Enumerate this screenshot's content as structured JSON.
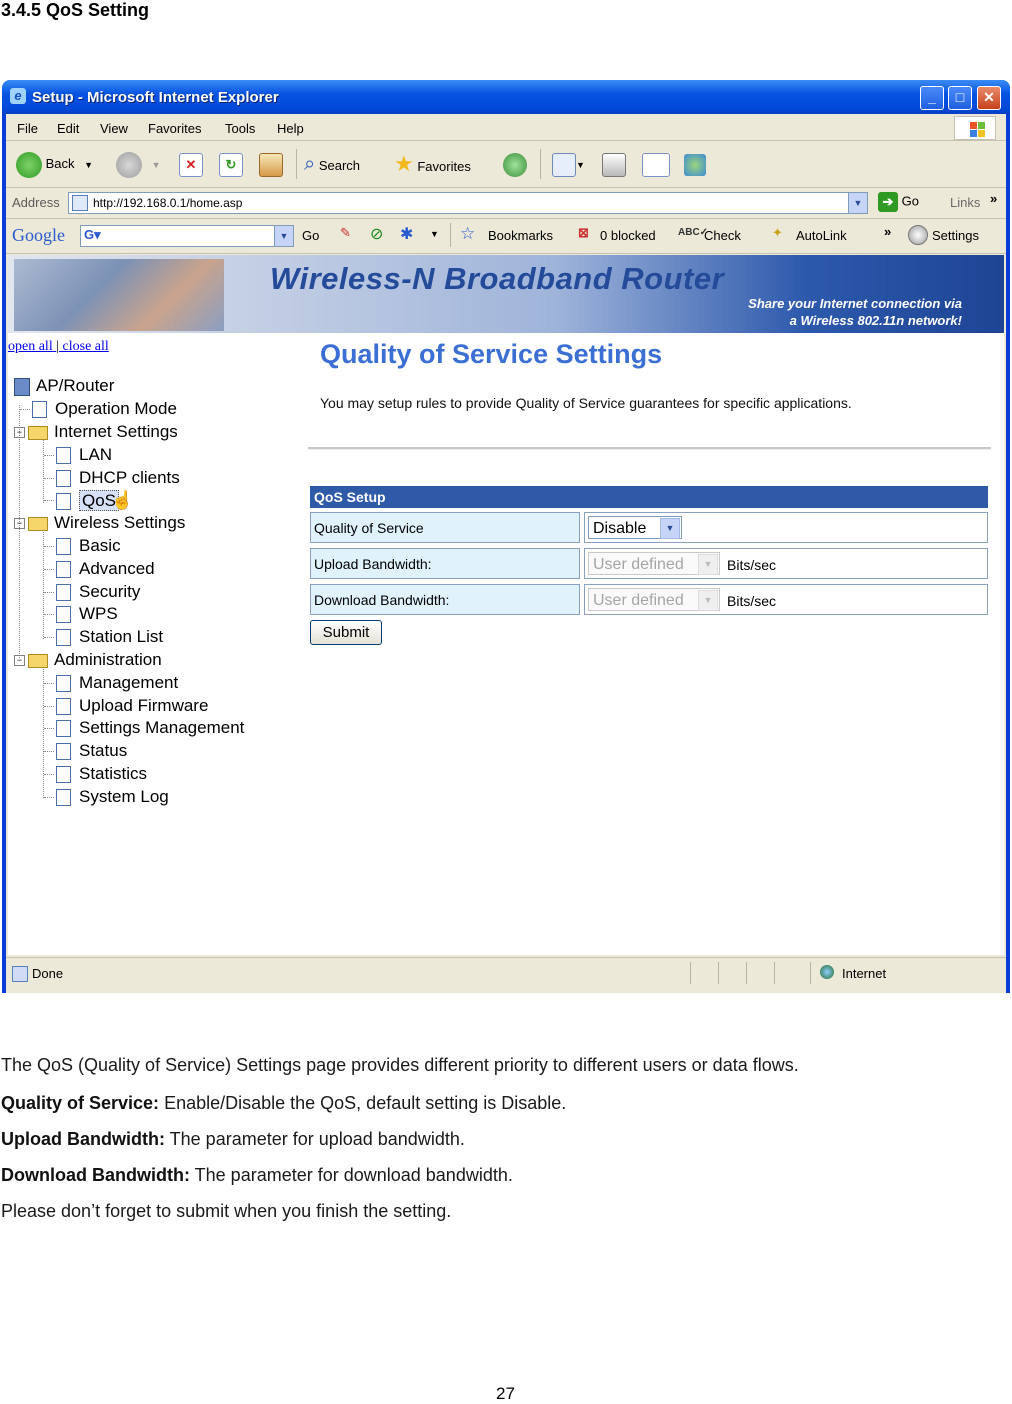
{
  "doc": {
    "heading": "3.4.5 QoS Setting",
    "intro": "The QoS (Quality of Service) Settings page provides different priority to different users or data flows.",
    "items": [
      {
        "term": "Quality of Service:",
        "desc": " Enable/Disable the QoS, default setting is Disable."
      },
      {
        "term": "Upload Bandwidth:",
        "desc": " The parameter for upload bandwidth."
      },
      {
        "term": "Download Bandwidth:",
        "desc": " The parameter for download bandwidth."
      }
    ],
    "closing": "Please don’t forget to submit when you finish the setting.",
    "page_number": "27"
  },
  "window": {
    "title": "Setup - Microsoft Internet Explorer",
    "controls": {
      "minimize": "_",
      "maximize": "□",
      "close": "✕"
    }
  },
  "menu": [
    "File",
    "Edit",
    "View",
    "Favorites",
    "Tools",
    "Help"
  ],
  "toolbar": {
    "back": "Back",
    "search": "Search",
    "favorites": "Favorites"
  },
  "address": {
    "label": "Address",
    "url": "http://192.168.0.1/home.asp",
    "go": "Go",
    "links": "Links"
  },
  "googlebar": {
    "logo": "Google",
    "go": "Go",
    "bookmarks": "Bookmarks",
    "blocked": "0 blocked",
    "check": "Check",
    "autolink": "AutoLink",
    "settings": "Settings"
  },
  "banner": {
    "title": "Wireless-N Broadband Router",
    "subtitle_line1": "Share your Internet connection via",
    "subtitle_line2": "a Wireless 802.11n network!"
  },
  "tree_links": {
    "open_all": "open all",
    "close_all": "close all",
    "separator": "|"
  },
  "tree": {
    "root": "AP/Router",
    "operation_mode": "Operation Mode",
    "internet": {
      "label": "Internet Settings",
      "children": [
        "LAN",
        "DHCP clients",
        "QoS"
      ]
    },
    "wireless": {
      "label": "Wireless Settings",
      "children": [
        "Basic",
        "Advanced",
        "Security",
        "WPS",
        "Station List"
      ]
    },
    "admin": {
      "label": "Administration",
      "children": [
        "Management",
        "Upload Firmware",
        "Settings Management",
        "Status",
        "Statistics",
        "System Log"
      ]
    }
  },
  "qos": {
    "title": "Quality of Service Settings",
    "description": "You may setup rules to provide Quality of Service guarantees for specific applications.",
    "table_header": "QoS Setup",
    "rows": [
      {
        "label": "Quality of Service",
        "value": "Disable"
      },
      {
        "label": "Upload Bandwidth:",
        "value": "User defined",
        "unit": "Bits/sec"
      },
      {
        "label": "Download Bandwidth:",
        "value": "User defined",
        "unit": "Bits/sec"
      }
    ],
    "submit": "Submit"
  },
  "status": {
    "left": "Done",
    "zone": "Internet"
  }
}
